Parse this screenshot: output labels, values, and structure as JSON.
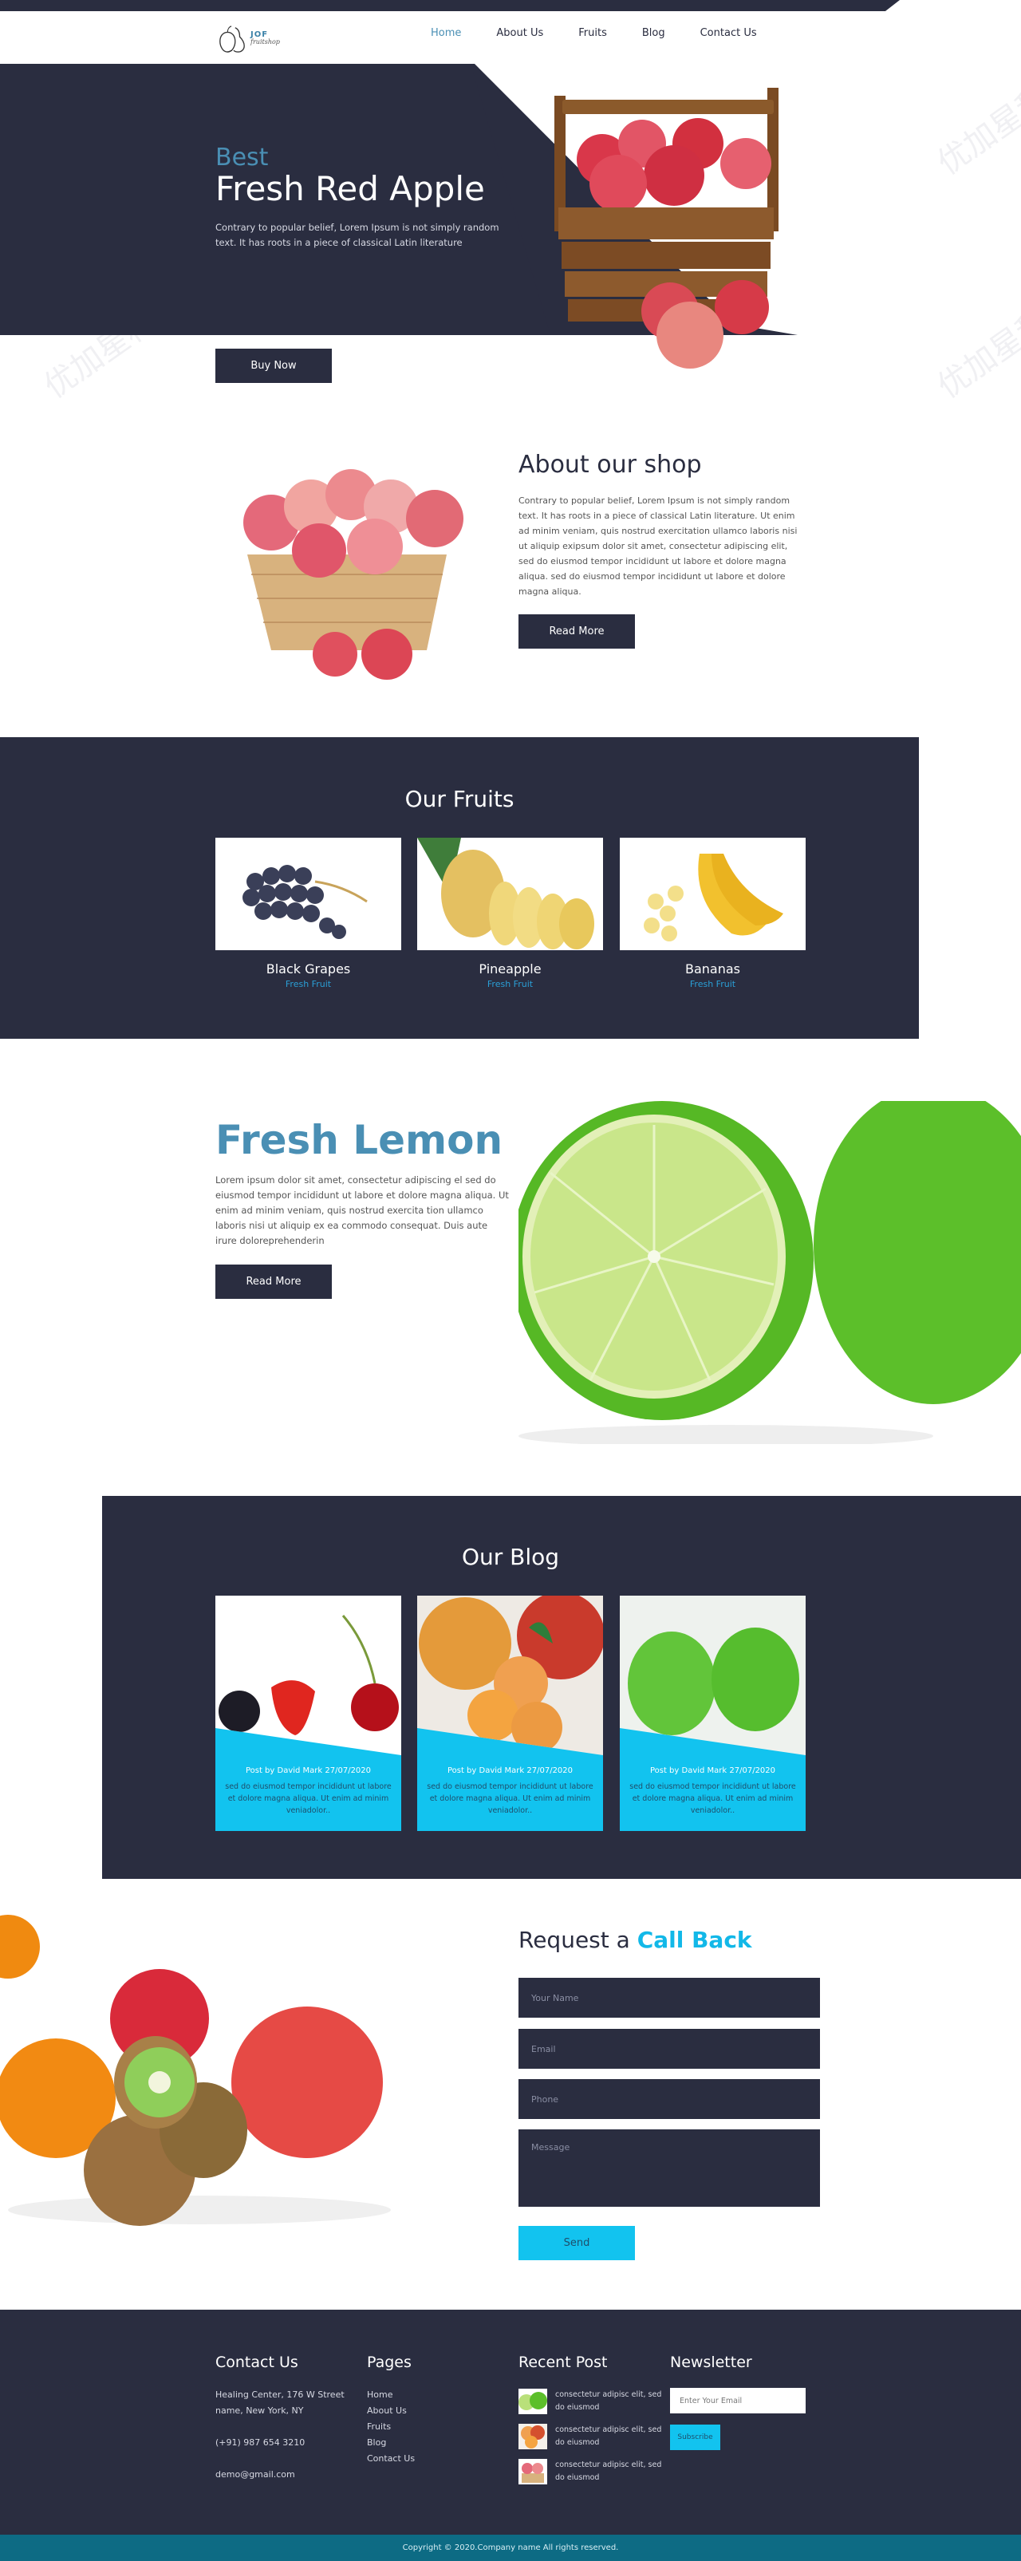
{
  "header": {
    "logo_name": "JOF",
    "logo_tagline": "fruitshop",
    "nav": [
      {
        "label": "Home",
        "active": true
      },
      {
        "label": "About Us",
        "active": false
      },
      {
        "label": "Fruits",
        "active": false
      },
      {
        "label": "Blog",
        "active": false
      },
      {
        "label": "Contact Us",
        "active": false
      }
    ]
  },
  "hero": {
    "kicker": "Best",
    "title": "Fresh Red Apple",
    "description": "Contrary to popular belief, Lorem Ipsum is not simply random text. It has roots in a piece of classical Latin literature",
    "button": "Buy Now"
  },
  "about": {
    "title": "About our shop",
    "description": "Contrary to popular belief, Lorem Ipsum is not simply random text. It has roots in a piece of classical Latin literature. Ut enim ad minim veniam, quis nostrud exercitation ullamco laboris nisi ut aliquip exipsum dolor sit amet, consectetur adipiscing elit, sed do eiusmod tempor incididunt ut labore et dolore magna aliqua. sed do eiusmod tempor incididunt ut labore et dolore magna aliqua.",
    "button": "Read More"
  },
  "fruits": {
    "title": "Our Fruits",
    "items": [
      {
        "name": "Black Grapes",
        "subtitle": "Fresh Fruit"
      },
      {
        "name": "Pineapple",
        "subtitle": "Fresh Fruit"
      },
      {
        "name": "Bananas",
        "subtitle": "Fresh Fruit"
      }
    ]
  },
  "lemon": {
    "title": "Fresh Lemon",
    "description": "Lorem ipsum dolor sit amet, consectetur adipiscing el sed do eiusmod tempor incididunt ut labore et dolore magna aliqua. Ut enim ad minim veniam, quis nostrud exercita tion ullamco laboris nisi ut aliquip ex ea commodo consequat. Duis aute irure doloreprehenderin",
    "button": "Read More"
  },
  "blog": {
    "title": "Our Blog",
    "posts": [
      {
        "meta": "Post by David Mark 27/07/2020",
        "text": "sed do eiusmod tempor incididunt ut labore et dolore magna aliqua. Ut enim ad minim veniadolor.."
      },
      {
        "meta": "Post by David Mark 27/07/2020",
        "text": "sed do eiusmod tempor incididunt ut labore et dolore magna aliqua. Ut enim ad minim veniadolor.."
      },
      {
        "meta": "Post by David Mark 27/07/2020",
        "text": "sed do eiusmod tempor incididunt ut labore et dolore magna aliqua. Ut enim ad minim veniadolor.."
      }
    ]
  },
  "callback": {
    "title_prefix": "Request a ",
    "title_accent": "Call Back",
    "name_placeholder": "Your Name",
    "email_placeholder": "Email",
    "phone_placeholder": "Phone",
    "message_placeholder": "Message",
    "button": "Send"
  },
  "footer": {
    "contact": {
      "heading": "Contact Us",
      "address": "Healing Center, 176 W Street name, New York, NY",
      "phone": "(+91) 987 654 3210",
      "email": "demo@gmail.com"
    },
    "pages": {
      "heading": "Pages",
      "links": [
        "Home",
        "About Us",
        "Fruits",
        "Blog",
        "Contact Us"
      ]
    },
    "recent": {
      "heading": "Recent Post",
      "posts": [
        {
          "text": "consectetur adipisc elit, sed do eiusmod",
          "thumb": "lime"
        },
        {
          "text": "consectetur adipisc elit, sed do eiusmod",
          "thumb": "peaches"
        },
        {
          "text": "consectetur adipisc elit, sed do eiusmod",
          "thumb": "apple-basket"
        }
      ]
    },
    "newsletter": {
      "heading": "Newsletter",
      "placeholder": "Enter Your Email",
      "button": "Subscribe"
    },
    "copyright": "Copyright © 2020.Company name All rights reserved."
  },
  "colors": {
    "dark_navy": "#2a2d40",
    "accent_blue": "#4a8fb4",
    "cyan": "#12c3ef",
    "teal_bar": "#0d6b84"
  },
  "watermark": "优加星科技"
}
